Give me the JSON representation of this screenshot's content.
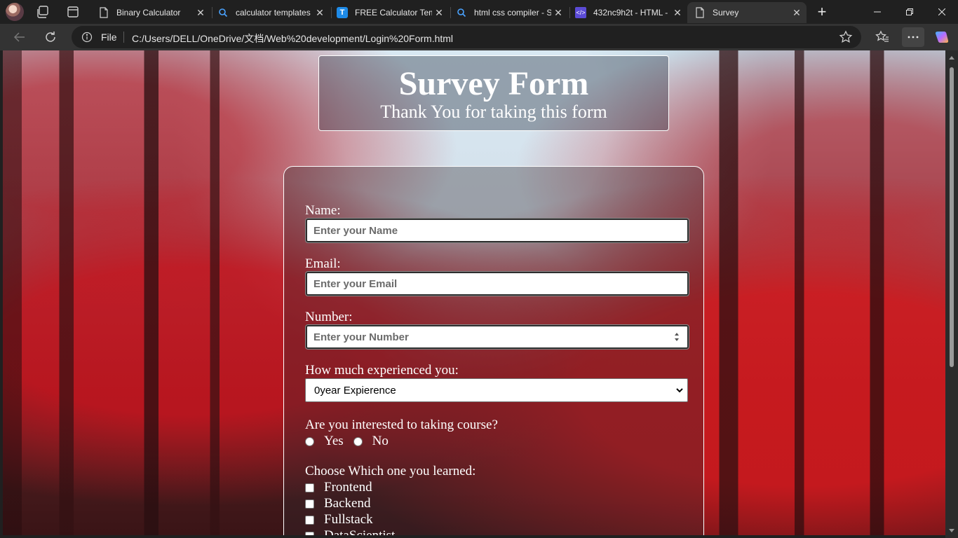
{
  "browser": {
    "tabs": [
      {
        "title": "Binary Calculator",
        "icon": "page-icon"
      },
      {
        "title": "calculator templates",
        "icon": "search-icon"
      },
      {
        "title": "FREE Calculator Temp",
        "icon": "t-app-icon"
      },
      {
        "title": "html css compiler - S",
        "icon": "search-icon"
      },
      {
        "title": "432nc9h2t - HTML -",
        "icon": "code-icon"
      },
      {
        "title": "Survey",
        "icon": "page-icon",
        "active": true
      }
    ],
    "address": {
      "scheme_label": "File",
      "url": "C:/Users/DELL/OneDrive/文档/Web%20development/Login%20Form.html"
    }
  },
  "page": {
    "header": {
      "title": "Survey Form",
      "subtitle": "Thank You for taking this form"
    },
    "form": {
      "name_label": "Name:",
      "name_placeholder": "Enter your Name",
      "email_label": "Email:",
      "email_placeholder": "Enter your Email",
      "number_label": "Number:",
      "number_placeholder": "Enter your Number",
      "experience_label": "How much experienced you:",
      "experience_selected": "0year Expierence",
      "course_question": "Are you interested to taking course?",
      "course_options": [
        "Yes",
        "No"
      ],
      "learned_question": "Choose Which one you learned:",
      "learned_options": [
        "Frontend",
        "Backend",
        "Fullstack",
        "DataScientist"
      ]
    }
  }
}
